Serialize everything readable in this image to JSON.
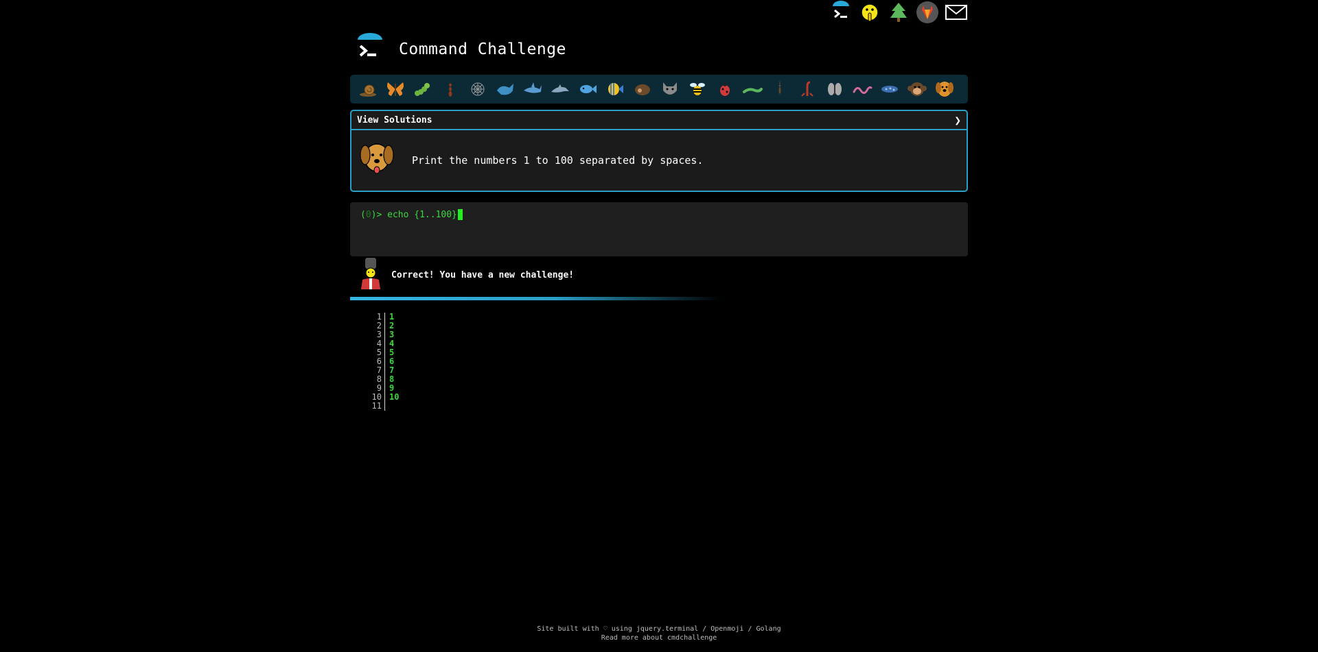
{
  "top_icons": [
    {
      "name": "cmdchallenge-icon"
    },
    {
      "name": "shushing-face-icon"
    },
    {
      "name": "evergreen-tree-icon"
    },
    {
      "name": "gitlab-icon"
    },
    {
      "name": "mail-icon"
    }
  ],
  "header": {
    "title": "Command Challenge"
  },
  "animals": [
    "snail-icon",
    "butterfly-icon",
    "caterpillar-icon",
    "ant-icon",
    "spider-web-icon",
    "whale-icon",
    "shark-icon",
    "dolphin-icon",
    "fish-icon",
    "tropical-fish-icon",
    "hedgehog-icon",
    "wolf-icon",
    "bee-icon",
    "ladybug-icon",
    "lizard-icon",
    "mosquito-icon",
    "scorpion-icon",
    "fly-icon",
    "worm-icon",
    "microbe-icon",
    "monkey-icon",
    "dog-icon"
  ],
  "challenge": {
    "view_solutions_label": "View Solutions",
    "chevron": "❯",
    "description": "Print the numbers 1 to 100 separated by spaces."
  },
  "terminal": {
    "prompt_open": "(",
    "prompt_status": "0",
    "prompt_close": ")> ",
    "command": "echo {1..100}"
  },
  "result": {
    "message": "Correct! You have a new challenge!"
  },
  "output": {
    "line_numbers": [
      "1",
      "2",
      "3",
      "4",
      "5",
      "6",
      "7",
      "8",
      "9",
      "10",
      "11"
    ],
    "values": [
      "1",
      "2",
      "3",
      "4",
      "5",
      "6",
      "7",
      "8",
      "9",
      "10",
      ""
    ]
  },
  "footer": {
    "prefix": "Site built with ♡ using ",
    "link1": "jquery.terminal",
    "sep1": " / ",
    "link2": "Openmoji",
    "sep2": " / ",
    "link3": "Golang",
    "line2": "Read more about cmdchallenge"
  },
  "colors": {
    "accent": "#2aa0c8",
    "terminal_green": "#3bd83b",
    "bar_bg": "#0b2a36"
  }
}
